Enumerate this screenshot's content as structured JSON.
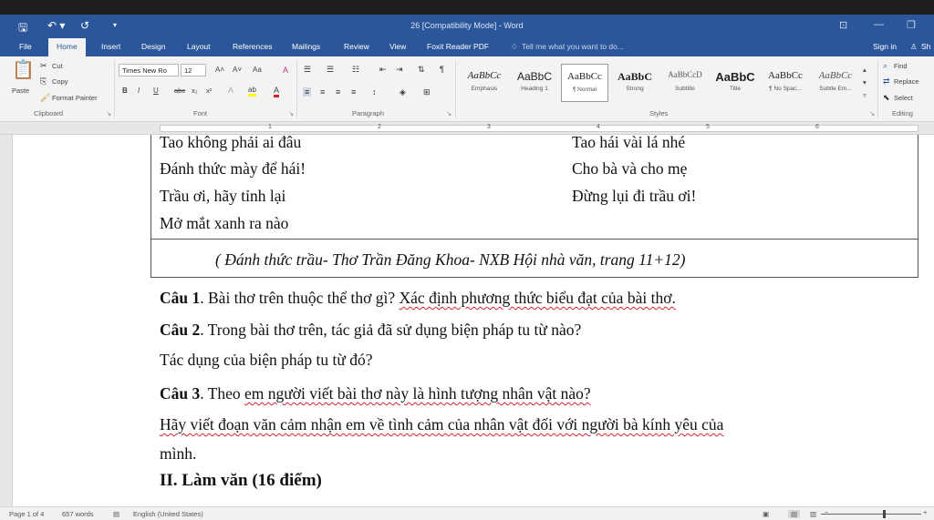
{
  "window": {
    "title": "26 [Compatibility Mode] - Word",
    "quick_access": {
      "save": "🖫",
      "undo": "↶ ▾",
      "redo": "↺",
      "customize": "▾"
    },
    "controls": {
      "ribbon_display": "⊡",
      "minimize": "—",
      "restore": "❐"
    }
  },
  "tabs": [
    "File",
    "Home",
    "Insert",
    "Design",
    "Layout",
    "References",
    "Mailings",
    "Review",
    "View",
    "Foxit Reader PDF"
  ],
  "active_tab": "Home",
  "tell_me": "Tell me what you want to do...",
  "signin": "Sign in",
  "share": "Sh",
  "clipboard": {
    "paste": "Paste",
    "cut": "Cut",
    "copy": "Copy",
    "format_painter": "Format Painter",
    "label": "Clipboard"
  },
  "font": {
    "name": "Times New Ro",
    "size": "12",
    "label": "Font",
    "bold": "B",
    "italic": "I",
    "underline": "U",
    "strike": "abc",
    "subscript": "x₂",
    "superscript": "x²",
    "grow": "A˄",
    "shrink": "A˅",
    "case": "Aa",
    "clear": "A",
    "effects": "A",
    "highlight": "ab",
    "color": "A"
  },
  "paragraph": {
    "label": "Paragraph"
  },
  "styles": {
    "label": "Styles",
    "items": [
      {
        "sample": "AaBbCc",
        "name": "Emphasis"
      },
      {
        "sample": "AaBbC",
        "name": "Heading 1"
      },
      {
        "sample": "AaBbCc",
        "name": "¶ Normal"
      },
      {
        "sample": "AaBbC",
        "name": "Strong"
      },
      {
        "sample": "AaBbCcD",
        "name": "Subtitle"
      },
      {
        "sample": "AaBbC",
        "name": "Title"
      },
      {
        "sample": "AaBbCc",
        "name": "¶ No Spac..."
      },
      {
        "sample": "AaBbCc",
        "name": "Subtle Em..."
      }
    ]
  },
  "editing": {
    "label": "Editing",
    "find": "Find",
    "replace": "Replace",
    "select": "Select"
  },
  "ruler_numbers": [
    "1",
    "2",
    "3",
    "4",
    "5",
    "6"
  ],
  "document": {
    "poem": {
      "left": [
        "Tao không phải ai đâu",
        "Đánh thức mày để hái!",
        "Trầu ơi, hãy tỉnh lại",
        "Mở mắt xanh ra nào"
      ],
      "right": [
        "Tao hái vài lá nhé",
        "Cho bà và cho mẹ",
        "Đừng lụi đi trầu ơi!"
      ]
    },
    "source": "( Đánh thức trầu- Thơ Trần Đăng Khoa- NXB Hội nhà văn, trang 11+12)",
    "q1_label": "Câu 1",
    "q1_plain": ". Bài thơ trên thuộc thể thơ gì?",
    "q1_under": "Xác định phương thức biểu đạt của bài thơ.",
    "q2_label": "Câu 2",
    "q2_text": ". Trong bài thơ trên, tác giả đã sử dụng biện pháp tu từ nào?",
    "q2_cont": "Tác dụng của biện pháp tu từ đó?",
    "q3_label": "Câu 3",
    "q3_pre": ".  Theo",
    "q3_under": "em người viết bài thơ này là hình tượng nhân vật nào?",
    "q3_line2": "Hãy viết đoạn văn cảm nhận em về tình cảm của nhân vật đối với người bà kính yêu của",
    "q3_line3": "mình.",
    "section2": "II. Làm văn (16 điểm)"
  },
  "status": {
    "page": "Page 1 of 4",
    "words": "657 words",
    "language": "English (United States)"
  }
}
